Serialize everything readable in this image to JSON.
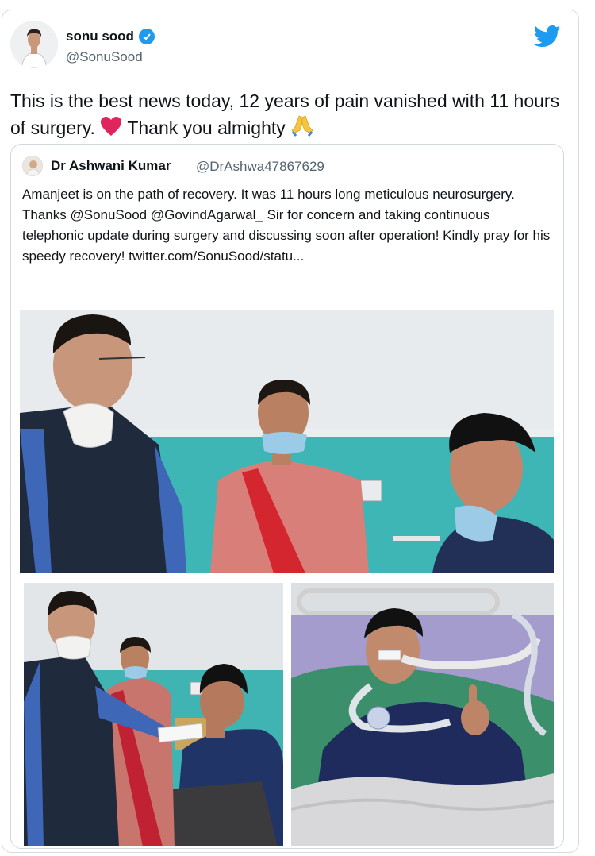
{
  "tweet": {
    "display_name": "sonu sood",
    "handle": "@SonuSood",
    "text_before_heart": "This is the best news today, 12 years of pain vanished with 11 hours of surgery.",
    "text_after_heart": "Thank you almighty",
    "heart_emoji": "heart-emoji",
    "pray_emoji": "folded-hands-emoji"
  },
  "quoted": {
    "display_name": "Dr Ashwani Kumar",
    "handle": "@DrAshwa47867629",
    "text": "Amanjeet is on the path of recovery. It was 11 hours long meticulous neurosurgery. Thanks @SonuSood @GovindAgarwal_ Sir for concern and taking continuous telephonic update during surgery and discussing soon after operation! Kindly pray for his speedy recovery! twitter.com/SonuSood/statu..."
  },
  "colors": {
    "twitter_blue": "#1d9bf0",
    "heart_red": "#e0245e",
    "text_primary": "#0f1419",
    "text_secondary": "#536471"
  }
}
